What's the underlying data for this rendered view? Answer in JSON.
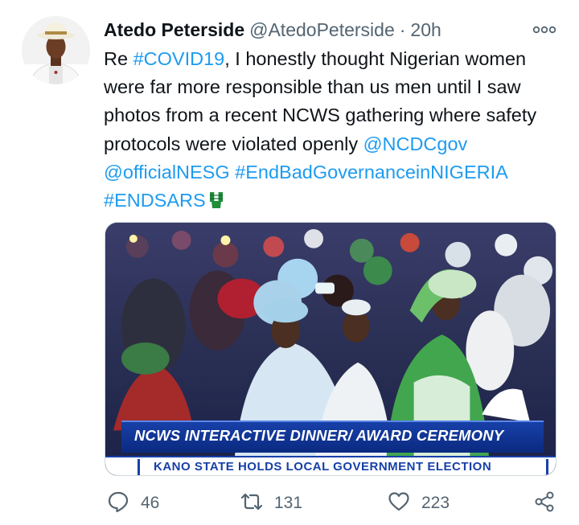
{
  "tweet": {
    "author_name": "Atedo Peterside",
    "author_handle": "@AtedoPeterside",
    "separator": "·",
    "time": "20h",
    "text_segments": [
      {
        "text": "Re ",
        "link": false
      },
      {
        "text": "#COVID19",
        "link": true
      },
      {
        "text": ", I honestly thought Nigerian women were far more responsible than us men until I saw photos from a recent NCWS gathering where safety protocols were violated openly ",
        "link": false
      },
      {
        "text": "@NCDCgov",
        "link": true
      },
      {
        "text": " ",
        "link": false
      },
      {
        "text": "@officialNESG",
        "link": true
      },
      {
        "text": " ",
        "link": false
      },
      {
        "text": "#EndBadGovernanceinNIGERIA",
        "link": true
      },
      {
        "text": " ",
        "link": false
      },
      {
        "text": "#ENDSARS",
        "link": true
      }
    ],
    "emoji": "raised-fist-emoji",
    "media": {
      "caption_main": "NCWS INTERACTIVE DINNER/ AWARD CEREMONY",
      "ticker": "KANO STATE HOLDS LOCAL GOVERNMENT ELECTION"
    },
    "actions": {
      "replies": "46",
      "retweets": "131",
      "likes": "223"
    }
  },
  "icons": {
    "more": "more-dots-icon",
    "reply": "reply-icon",
    "retweet": "retweet-icon",
    "like": "heart-icon",
    "share": "share-icon"
  },
  "colors": {
    "link": "#1d9bf0",
    "secondary_text": "#536471",
    "primary_text": "#0f1419",
    "caption_bar": "#1740a8"
  }
}
